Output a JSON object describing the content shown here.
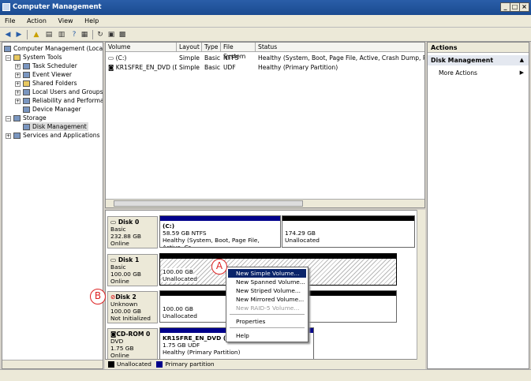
{
  "window": {
    "title": "Computer Management",
    "minimize": "_",
    "maximize": "□",
    "close": "×"
  },
  "menu": [
    "File",
    "Action",
    "View",
    "Help"
  ],
  "tree": {
    "root": "Computer Management (Local)",
    "system_tools": "System Tools",
    "task_scheduler": "Task Scheduler",
    "event_viewer": "Event Viewer",
    "shared_folders": "Shared Folders",
    "local_users": "Local Users and Groups",
    "reliability": "Reliability and Performanc",
    "device_manager": "Device Manager",
    "storage": "Storage",
    "disk_management": "Disk Management",
    "services": "Services and Applications"
  },
  "volumes": {
    "columns": [
      "Volume",
      "Layout",
      "Type",
      "File System",
      "Status"
    ],
    "rows": [
      {
        "volume": "(C:)",
        "layout": "Simple",
        "type": "Basic",
        "fs": "NTFS",
        "status": "Healthy (System, Boot, Page File, Active, Crash Dump, Primary Pa"
      },
      {
        "volume": "KR1SFRE_EN_DVD (D:)",
        "layout": "Simple",
        "type": "Basic",
        "fs": "UDF",
        "status": "Healthy (Primary Partition)"
      }
    ]
  },
  "disks": {
    "disk0": {
      "name": "Disk 0",
      "type": "Basic",
      "size": "232.88 GB",
      "state": "Online",
      "p1_name": "(C:)",
      "p1_line2": "58.59 GB NTFS",
      "p1_line3": "Healthy (System, Boot, Page File, Active, Cr.",
      "p2_line1": "174.29 GB",
      "p2_line2": "Unallocated"
    },
    "disk1": {
      "name": "Disk 1",
      "type": "Basic",
      "size": "100.00 GB",
      "state": "Online",
      "p_line1": "100.00 GB",
      "p_line2": "Unallocated"
    },
    "disk2": {
      "name": "Disk 2",
      "type": "Unknown",
      "size": "100.00 GB",
      "state": "Not Initialized",
      "p_line1": "100.00 GB",
      "p_line2": "Unallocated"
    },
    "cdrom": {
      "name": "CD-ROM 0",
      "type": "DVD",
      "size": "1.75 GB",
      "state": "Online",
      "p_name": "KR1SFRE_EN_DVD (D:)",
      "p_line2": "1.75 GB UDF",
      "p_line3": "Healthy (Primary Partition)"
    }
  },
  "legend": {
    "unallocated": "Unallocated",
    "primary": "Primary partition",
    "unallocated_color": "#000000",
    "primary_color": "#00008b"
  },
  "actions": {
    "header": "Actions",
    "section": "Disk Management",
    "more": "More Actions"
  },
  "context_menu": {
    "items": [
      "New Simple Volume...",
      "New Spanned Volume...",
      "New Striped Volume...",
      "New Mirrored Volume...",
      "New RAID-5 Volume..."
    ],
    "properties": "Properties",
    "help": "Help"
  },
  "callouts": {
    "a": "A",
    "b": "B"
  },
  "colors": {
    "title_bar": "#1a4a90",
    "primary_bar": "#00008b",
    "selection": "#0a246a",
    "callout": "#dd2222"
  }
}
